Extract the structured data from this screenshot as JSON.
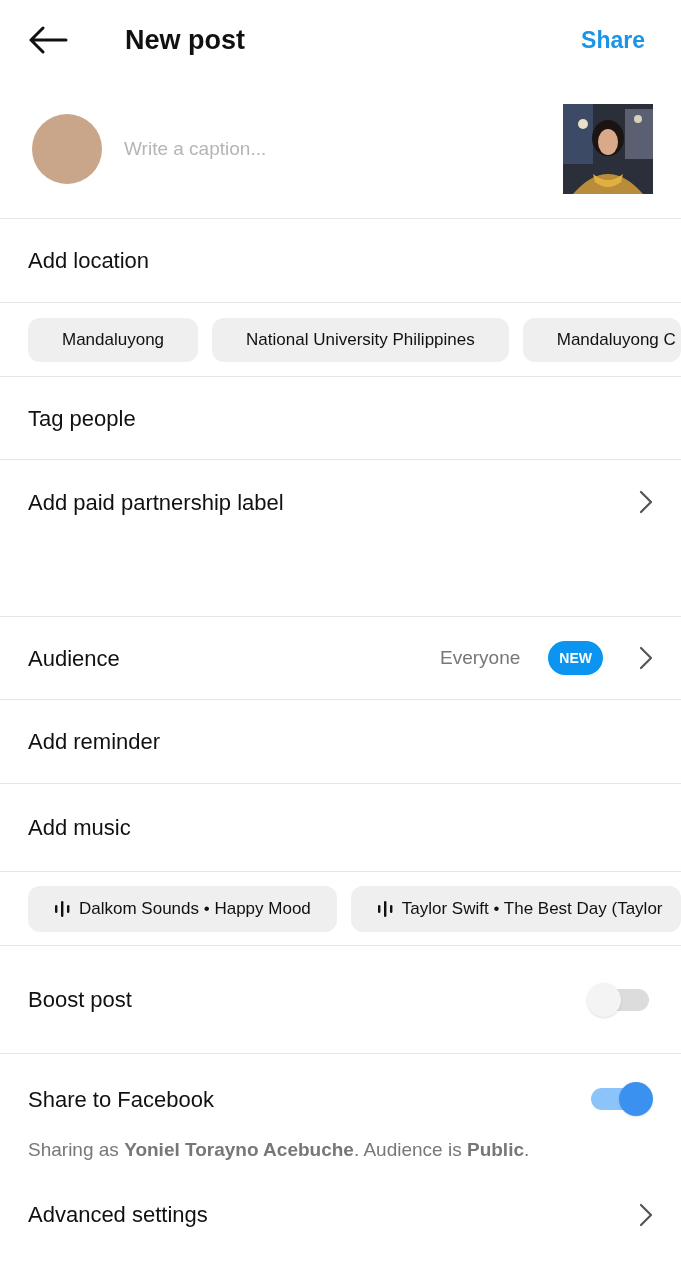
{
  "header": {
    "title": "New post",
    "action": "Share"
  },
  "caption": {
    "placeholder": "Write a caption..."
  },
  "location": {
    "label": "Add location"
  },
  "location_suggestions": [
    "Mandaluyong",
    "National University Philippines",
    "Mandaluyong C"
  ],
  "tag_people": {
    "label": "Tag people"
  },
  "paid_partnership": {
    "label": "Add paid partnership label"
  },
  "audience": {
    "label": "Audience",
    "value": "Everyone",
    "badge": "NEW"
  },
  "reminder": {
    "label": "Add reminder"
  },
  "music": {
    "label": "Add music"
  },
  "music_suggestions": [
    "Dalkom Sounds • Happy Mood",
    "Taylor Swift • The Best Day (Taylor"
  ],
  "boost_post": {
    "label": "Boost post",
    "on": false
  },
  "share_to_facebook": {
    "label": "Share to Facebook",
    "on": true
  },
  "sharing_note": "Sharing as **Yoniel Torayno Acebuche**. Audience is **Public**.",
  "advanced_settings": {
    "label": "Advanced settings"
  }
}
